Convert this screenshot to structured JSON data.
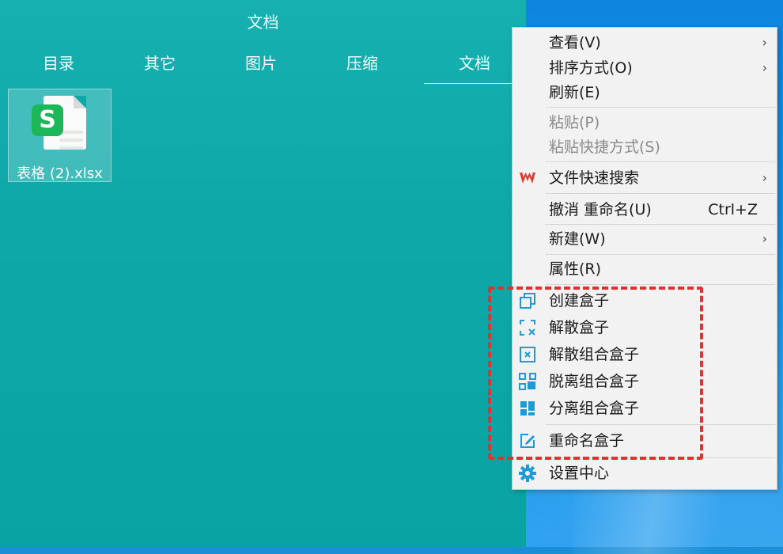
{
  "panel": {
    "title": "文档",
    "tabs": [
      "目录",
      "其它",
      "图片",
      "压缩",
      "文档"
    ],
    "active_tab": "文档",
    "file": {
      "name": "表格 (2).xlsx",
      "icon": "spreadsheet-file-icon",
      "badge": "S"
    }
  },
  "menu": {
    "view": {
      "label": "查看(V)"
    },
    "sort": {
      "label": "排序方式(O)"
    },
    "refresh": {
      "label": "刷新(E)"
    },
    "paste": {
      "label": "粘贴(P)"
    },
    "paste_shortcut": {
      "label": "粘贴快捷方式(S)"
    },
    "file_search": {
      "label": "文件快速搜索",
      "icon": "wps-logo-icon"
    },
    "undo_rename": {
      "label": "撤消 重命名(U)",
      "shortcut": "Ctrl+Z"
    },
    "new": {
      "label": "新建(W)"
    },
    "properties": {
      "label": "属性(R)"
    },
    "create_box": {
      "label": "创建盒子",
      "icon": "create-box-icon"
    },
    "dissolve_box": {
      "label": "解散盒子",
      "icon": "dissolve-box-icon"
    },
    "dissolve_group": {
      "label": "解散组合盒子",
      "icon": "dissolve-group-icon"
    },
    "detach_group": {
      "label": "脱离组合盒子",
      "icon": "detach-group-icon"
    },
    "separate_group": {
      "label": "分离组合盒子",
      "icon": "separate-group-icon"
    },
    "rename_box": {
      "label": "重命名盒子",
      "icon": "rename-box-icon"
    },
    "settings": {
      "label": "设置中心",
      "icon": "gear-icon"
    }
  },
  "colors": {
    "panel_teal": "#0ea8a8",
    "menu_bg": "#f2f2f2",
    "icon_blue": "#1d9bd6",
    "highlight_red": "#e53030",
    "wps_red": "#e03a2f",
    "sheet_green": "#1cb759"
  }
}
